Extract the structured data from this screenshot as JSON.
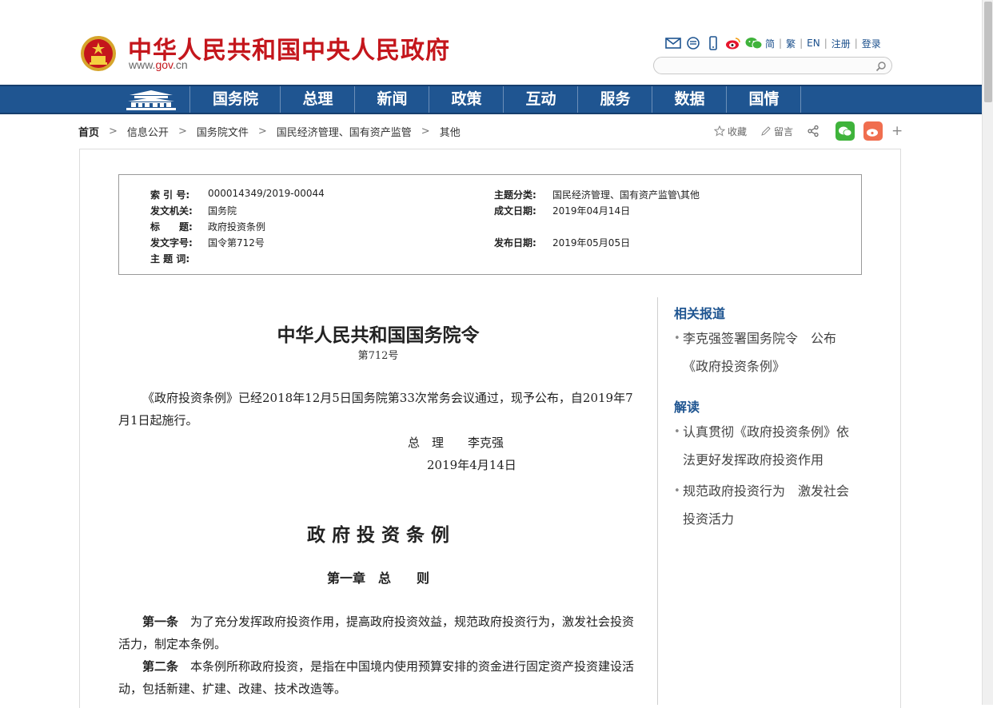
{
  "header": {
    "title": "中华人民共和国中央人民政府",
    "domain_prefix": "www.",
    "domain_brand": "gov",
    "domain_suffix": ".cn",
    "icons": [
      "mail-icon",
      "message-icon",
      "mobile-icon",
      "weibo-icon",
      "wechat-icon"
    ],
    "lang_links": [
      "简",
      "繁",
      "EN",
      "注册",
      "登录"
    ],
    "search_placeholder": ""
  },
  "nav": {
    "items": [
      "国务院",
      "总理",
      "新闻",
      "政策",
      "互动",
      "服务",
      "数据",
      "国情"
    ]
  },
  "breadcrumb": [
    "首页",
    "信息公开",
    "国务院文件",
    "国民经济管理、国有资产监管",
    "其他"
  ],
  "tools": {
    "favorite": "收藏",
    "comment": "留言"
  },
  "meta": {
    "index_label": "索 引 号:",
    "index_value": "000014349/2019-00044",
    "topic_label": "主题分类:",
    "topic_value": "国民经济管理、国有资产监管\\其他",
    "issuer_label": "发文机关:",
    "issuer_value": "国务院",
    "date_made_label": "成文日期:",
    "date_made_value": "2019年04月14日",
    "title_label": "标　　题:",
    "title_value": "政府投资条例",
    "doc_no_label": "发文字号:",
    "doc_no_value": "国令第712号",
    "publish_label": "发布日期:",
    "publish_value": "2019年05月05日",
    "keywords_label": "主 题 词:",
    "keywords_value": ""
  },
  "article": {
    "title": "中华人民共和国国务院令",
    "order_no": "第712号",
    "intro": "《政府投资条例》已经2018年12月5日国务院第33次常务会议通过，现予公布，自2019年7月1日起施行。",
    "signature": "总　理　　李克强",
    "sign_date": "2019年4月14日",
    "reg_title": "政 府 投 资 条 例",
    "chapter": "第一章　总　　则",
    "art1_label": "第一条",
    "art1_text": "为了充分发挥政府投资作用，提高政府投资效益，规范政府投资行为，激发社会投资活力，制定本条例。",
    "art2_label": "第二条",
    "art2_text": "本条例所称政府投资，是指在中国境内使用预算安排的资金进行固定资产投资建设活动，包括新建、扩建、改建、技术改造等。"
  },
  "sidebar": {
    "related_heading": "相关报道",
    "related": [
      "李克强签署国务院令　公布《政府投资条例》"
    ],
    "interp_heading": "解读",
    "interp": [
      "认真贯彻《政府投资条例》依法更好发挥政府投资作用",
      "规范政府投资行为　激发社会投资活力"
    ]
  },
  "colors": {
    "brand_red": "#c4161c",
    "nav_blue": "#1f5591",
    "wechat_green": "#3fb33b",
    "weibo_orange": "#f06e4f"
  }
}
